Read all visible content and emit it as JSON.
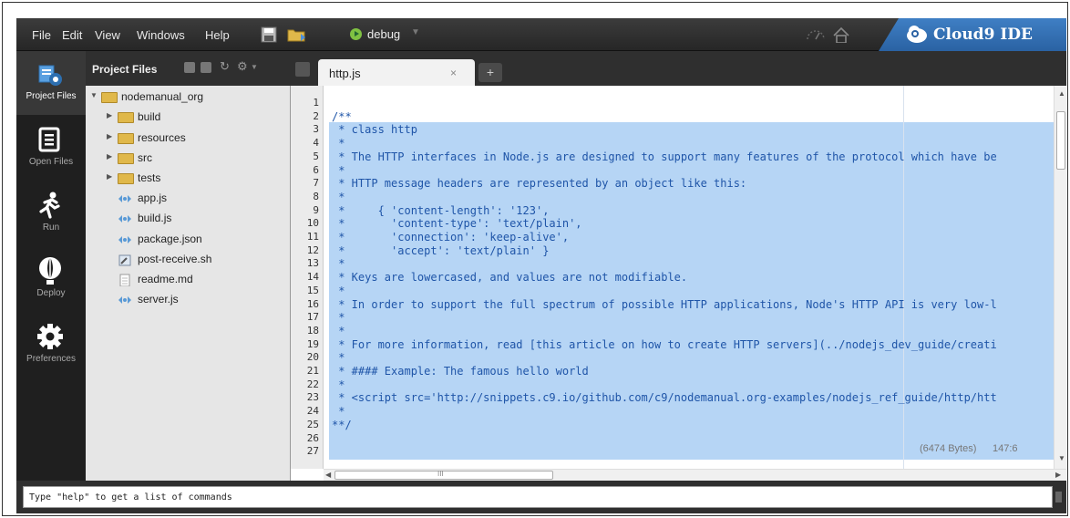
{
  "menu": {
    "items": [
      "File",
      "Edit",
      "View",
      "Windows",
      "Help"
    ],
    "debug_label": "debug",
    "brand": "Cloud9 IDE"
  },
  "leftbar": {
    "items": [
      {
        "label": "Project Files",
        "icon": "project-files-icon",
        "active": true
      },
      {
        "label": "Open Files",
        "icon": "open-files-icon"
      },
      {
        "label": "Run",
        "icon": "run-icon"
      },
      {
        "label": "Deploy",
        "icon": "deploy-icon"
      },
      {
        "label": "Preferences",
        "icon": "preferences-icon"
      }
    ]
  },
  "project": {
    "title": "Project Files",
    "tree": [
      {
        "name": "nodemanual_org",
        "type": "folder",
        "expanded": true
      },
      {
        "name": "build",
        "type": "folder"
      },
      {
        "name": "resources",
        "type": "folder"
      },
      {
        "name": "src",
        "type": "folder"
      },
      {
        "name": "tests",
        "type": "folder"
      },
      {
        "name": "app.js",
        "type": "js"
      },
      {
        "name": "build.js",
        "type": "js"
      },
      {
        "name": "package.json",
        "type": "js"
      },
      {
        "name": "post-receive.sh",
        "type": "sh"
      },
      {
        "name": "readme.md",
        "type": "md"
      },
      {
        "name": "server.js",
        "type": "js"
      }
    ]
  },
  "editor": {
    "tab": "http.js",
    "tab_close": "×",
    "tab_add": "+",
    "line_numbers": [
      "1",
      "2",
      "3",
      "4",
      "5",
      "6",
      "7",
      "8",
      "9",
      "10",
      "11",
      "12",
      "13",
      "14",
      "15",
      "16",
      "17",
      "18",
      "19",
      "20",
      "21",
      "22",
      "23",
      "24",
      "25",
      "26",
      "27"
    ],
    "lines": [
      "",
      "/**",
      " * class http",
      " *",
      " * The HTTP interfaces in Node.js are designed to support many features of the protocol which have be",
      " *",
      " * HTTP message headers are represented by an object like this:",
      " *",
      " *     { 'content-length': '123',",
      " *       'content-type': 'text/plain',",
      " *       'connection': 'keep-alive',",
      " *       'accept': 'text/plain' }",
      " *",
      " * Keys are lowercased, and values are not modifiable.",
      " *",
      " * In order to support the full spectrum of possible HTTP applications, Node's HTTP API is very low-l",
      " *",
      " *",
      " * For more information, read [this article on how to create HTTP servers](../nodejs_dev_guide/creati",
      " *",
      " * #### Example: The famous hello world",
      " *",
      " * <script src='http://snippets.c9.io/github.com/c9/nodemanual.org-examples/nodejs_ref_guide/http/htt",
      " *",
      "**/",
      "",
      ""
    ],
    "status_size": "(6474 Bytes)",
    "status_pos": "147:6",
    "hscroll_thumb_label": "III"
  },
  "console": {
    "placeholder": "Type \"help\" to get a list of commands"
  },
  "colors": {
    "selection": "#b6d5f5",
    "code_text": "#1f55a8",
    "brand": "#2a62a3"
  }
}
